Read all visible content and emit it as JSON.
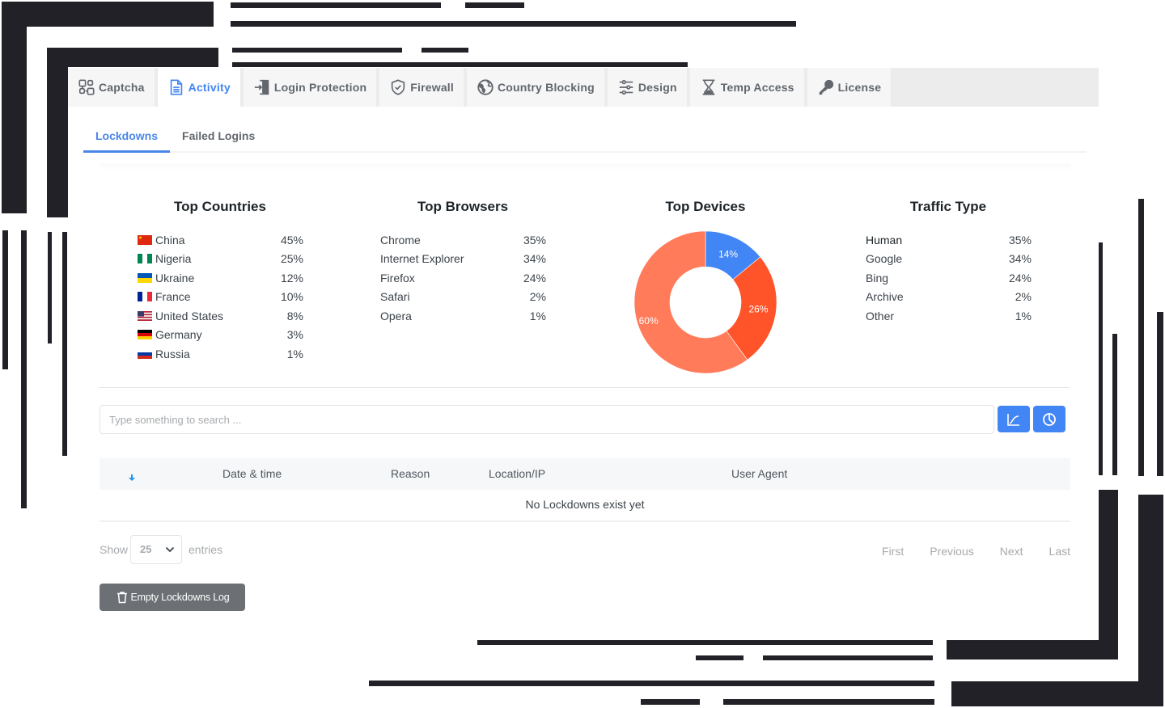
{
  "tabs": [
    {
      "label": "Captcha",
      "icon": "captcha-icon",
      "active": false
    },
    {
      "label": "Activity",
      "icon": "document-icon",
      "active": true
    },
    {
      "label": "Login Protection",
      "icon": "login-door-icon",
      "active": false
    },
    {
      "label": "Firewall",
      "icon": "shield-check-icon",
      "active": false
    },
    {
      "label": "Country Blocking",
      "icon": "globe-icon",
      "active": false
    },
    {
      "label": "Design",
      "icon": "sliders-icon",
      "active": false
    },
    {
      "label": "Temp Access",
      "icon": "hourglass-icon",
      "active": false
    },
    {
      "label": "License",
      "icon": "key-icon",
      "active": false
    }
  ],
  "subtabs": [
    {
      "label": "Lockdowns",
      "active": true
    },
    {
      "label": "Failed Logins",
      "active": false
    }
  ],
  "stats": {
    "countries": {
      "title": "Top Countries",
      "items": [
        {
          "name": "China",
          "value": "45%",
          "flag": "cn"
        },
        {
          "name": "Nigeria",
          "value": "25%",
          "flag": "ng"
        },
        {
          "name": "Ukraine",
          "value": "12%",
          "flag": "ua"
        },
        {
          "name": "France",
          "value": "10%",
          "flag": "fr"
        },
        {
          "name": "United States",
          "value": "8%",
          "flag": "us"
        },
        {
          "name": "Germany",
          "value": "3%",
          "flag": "de"
        },
        {
          "name": "Russia",
          "value": "1%",
          "flag": "ru"
        }
      ]
    },
    "browsers": {
      "title": "Top Browsers",
      "items": [
        {
          "name": "Chrome",
          "value": "35%"
        },
        {
          "name": "Internet Explorer",
          "value": "34%"
        },
        {
          "name": "Firefox",
          "value": "24%"
        },
        {
          "name": "Safari",
          "value": "2%"
        },
        {
          "name": "Opera",
          "value": "1%"
        }
      ]
    },
    "devices": {
      "title": "Top Devices"
    },
    "traffic": {
      "title": "Traffic Type",
      "items": [
        {
          "name": "Human",
          "value": "35%"
        },
        {
          "name": "Google",
          "value": "34%"
        },
        {
          "name": "Bing",
          "value": "24%"
        },
        {
          "name": "Archive",
          "value": "2%"
        },
        {
          "name": "Other",
          "value": "1%"
        }
      ]
    }
  },
  "chart_data": {
    "type": "pie",
    "title": "Top Devices",
    "donut": true,
    "slices": [
      {
        "label": "14%",
        "value": 14,
        "color": "#4285f4"
      },
      {
        "label": "26%",
        "value": 26,
        "color": "#ff5429"
      },
      {
        "label": "60%",
        "value": 60,
        "color": "#ff7b5a"
      }
    ]
  },
  "search": {
    "placeholder": "Type something to search ...",
    "value": ""
  },
  "toolbar": {
    "chart_button_icon": "line-chart-icon",
    "pie_button_icon": "pie-chart-icon"
  },
  "table": {
    "sort_icon": "sort-down-icon",
    "columns": [
      "Date & time",
      "Reason",
      "Location/IP",
      "User Agent"
    ],
    "empty_message": "No Lockdowns exist yet"
  },
  "pagination": {
    "show_label": "Show",
    "entries_value": "25",
    "entries_label": "entries",
    "first": "First",
    "previous": "Previous",
    "next": "Next",
    "last": "Last"
  },
  "actions": {
    "empty_log_label": "Empty Lockdowns Log"
  },
  "colors": {
    "accent": "#4285f4",
    "button_gray": "#6c7074",
    "decoration": "#222127"
  }
}
